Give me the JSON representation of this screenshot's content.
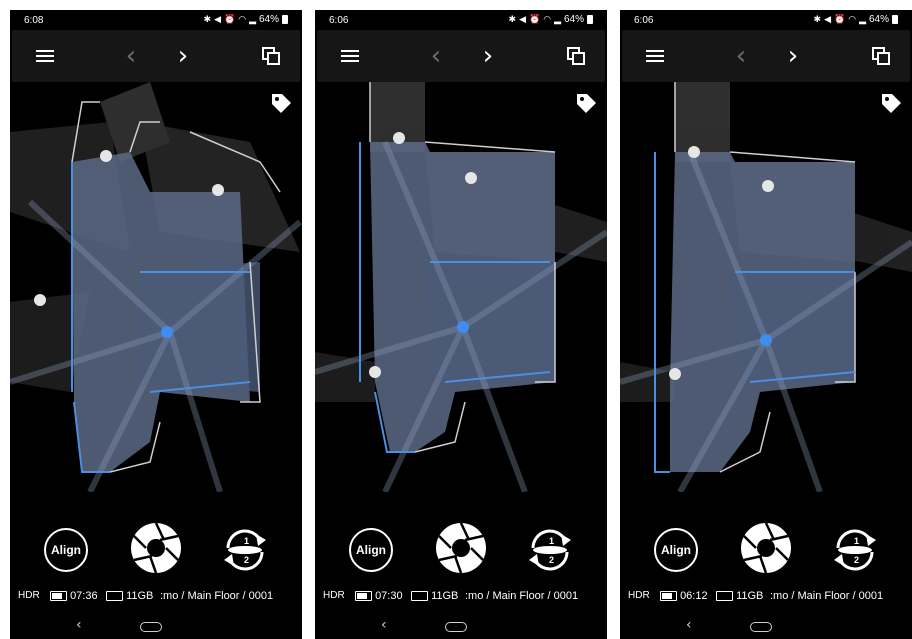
{
  "screens": [
    {
      "status": {
        "time": "6:08",
        "battery_pct": "64%"
      },
      "controls": {
        "align_label": "Align"
      },
      "cycle_numbers": {
        "top": "1",
        "bottom": "2"
      },
      "info": {
        "hdr": "HDR",
        "battery_time": "07:36",
        "storage": "11GB",
        "path": ":mo  /  Main Floor  /  0001"
      }
    },
    {
      "status": {
        "time": "6:06",
        "battery_pct": "64%"
      },
      "controls": {
        "align_label": "Align"
      },
      "cycle_numbers": {
        "top": "1",
        "bottom": "2"
      },
      "info": {
        "hdr": "HDR",
        "battery_time": "07:30",
        "storage": "11GB",
        "path": ":mo  /  Main Floor  /  0001"
      }
    },
    {
      "status": {
        "time": "6:06",
        "battery_pct": "64%"
      },
      "controls": {
        "align_label": "Align"
      },
      "cycle_numbers": {
        "top": "1",
        "bottom": "2"
      },
      "info": {
        "hdr": "HDR",
        "battery_time": "06:12",
        "storage": "11GB",
        "path": ":mo  /  Main Floor  /  0001"
      }
    }
  ],
  "icons": {
    "menu": "hamburger-menu-icon",
    "prev": "chevron-left-icon",
    "next": "chevron-right-icon",
    "copy": "copy-icon",
    "tag": "tag-icon",
    "shutter": "camera-shutter-icon",
    "cycle": "cycle-1-2-icon"
  },
  "colors": {
    "background": "#000000",
    "map_fill": "#5a6a86",
    "scan_line": "#4a8fe0",
    "accent_blue": "#3d8ef0"
  }
}
